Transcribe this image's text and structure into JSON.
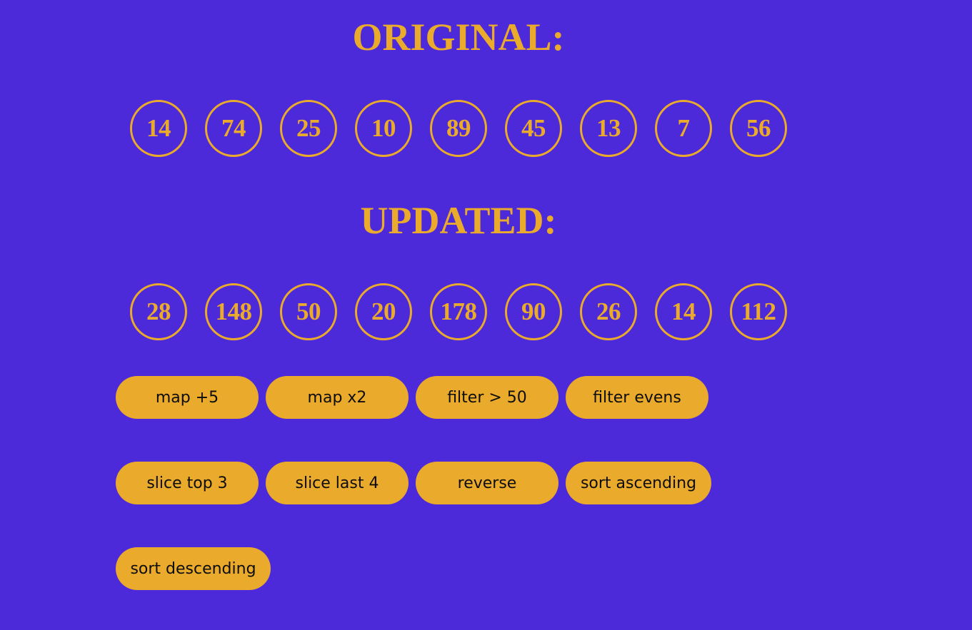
{
  "headings": {
    "original": "ORIGINAL:",
    "updated": "UPDATED:"
  },
  "original_values": [
    "14",
    "74",
    "25",
    "10",
    "89",
    "45",
    "13",
    "7",
    "56"
  ],
  "updated_values": [
    "28",
    "148",
    "50",
    "20",
    "178",
    "90",
    "26",
    "14",
    "112"
  ],
  "buttons": [
    "map +5",
    "map x2",
    "filter > 50",
    "filter evens",
    "slice top 3",
    "slice last 4",
    "reverse",
    "sort ascending",
    "sort descending"
  ],
  "colors": {
    "background": "#4c29d9",
    "accent": "#eaaa2c",
    "button_text": "#0d0d0d"
  }
}
